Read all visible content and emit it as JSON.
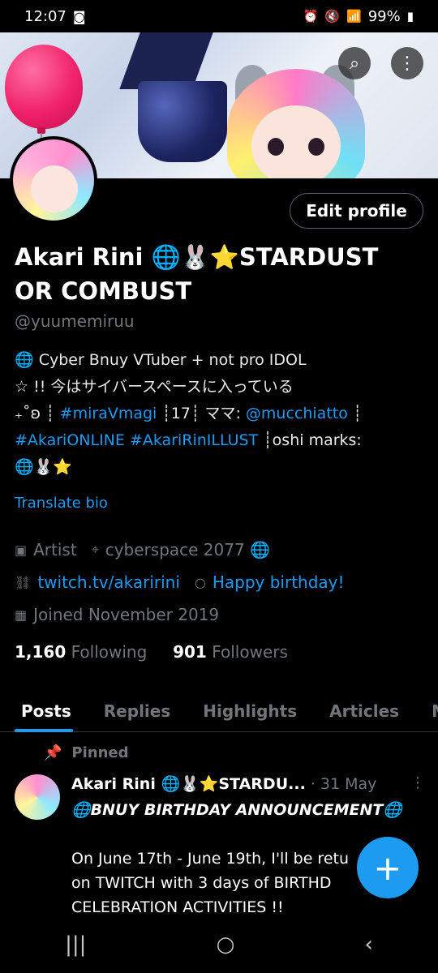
{
  "status": {
    "time": "12:07",
    "battery": "99%"
  },
  "header": {
    "search_icon": "search-icon",
    "more_icon": "more-icon"
  },
  "profile": {
    "edit_label": "Edit profile",
    "name": "Akari Rini 🌐🐰⭐STARDUST OR COMBUST",
    "handle": "@yuumemiruu",
    "bio_line1": "🌐 Cyber Bnuy VTuber + not pro IDOL",
    "bio_line2": "☆ !!  今はサイバースペースに入っている",
    "bio_line3_pre": "₊˚ʚ ┊ ",
    "bio_tag1": "#miraVmagi",
    "bio_line3_mid": " ┊17┊ ママ: ",
    "bio_mention": "@mucchiatto",
    "bio_line3_post": " ┊",
    "bio_tag2": "#AkariONLINE",
    "bio_tag3": "#AkariRinILLUST",
    "bio_line4_post": " ┊oshi marks:",
    "bio_line5": "🌐🐰⭐",
    "translate": "Translate bio",
    "category": "Artist",
    "location": "cyberspace 2077 🌐",
    "website": "twitch.tv/akaririni",
    "birthday": "Happy birthday!",
    "joined": "Joined November 2019",
    "following_count": "1,160",
    "following_label": "Following",
    "followers_count": "901",
    "followers_label": "Followers"
  },
  "tabs": [
    "Posts",
    "Replies",
    "Highlights",
    "Articles",
    "M"
  ],
  "post": {
    "pinned_label": "Pinned",
    "author": "Akari Rini 🌐🐰⭐STARDU...",
    "date": "· 31 May",
    "title": "🌐BNUY BIRTHDAY ANNOUNCEMENT🌐",
    "line1": "On June 17th - June 19th, I'll be retu",
    "line2": "on TWITCH with 3 days of BIRTHD",
    "line3": "CELEBRATION ACTIVITIES !!"
  },
  "fab_label": "+",
  "nav": {
    "recents": "|||",
    "home": "○",
    "back": "‹"
  }
}
